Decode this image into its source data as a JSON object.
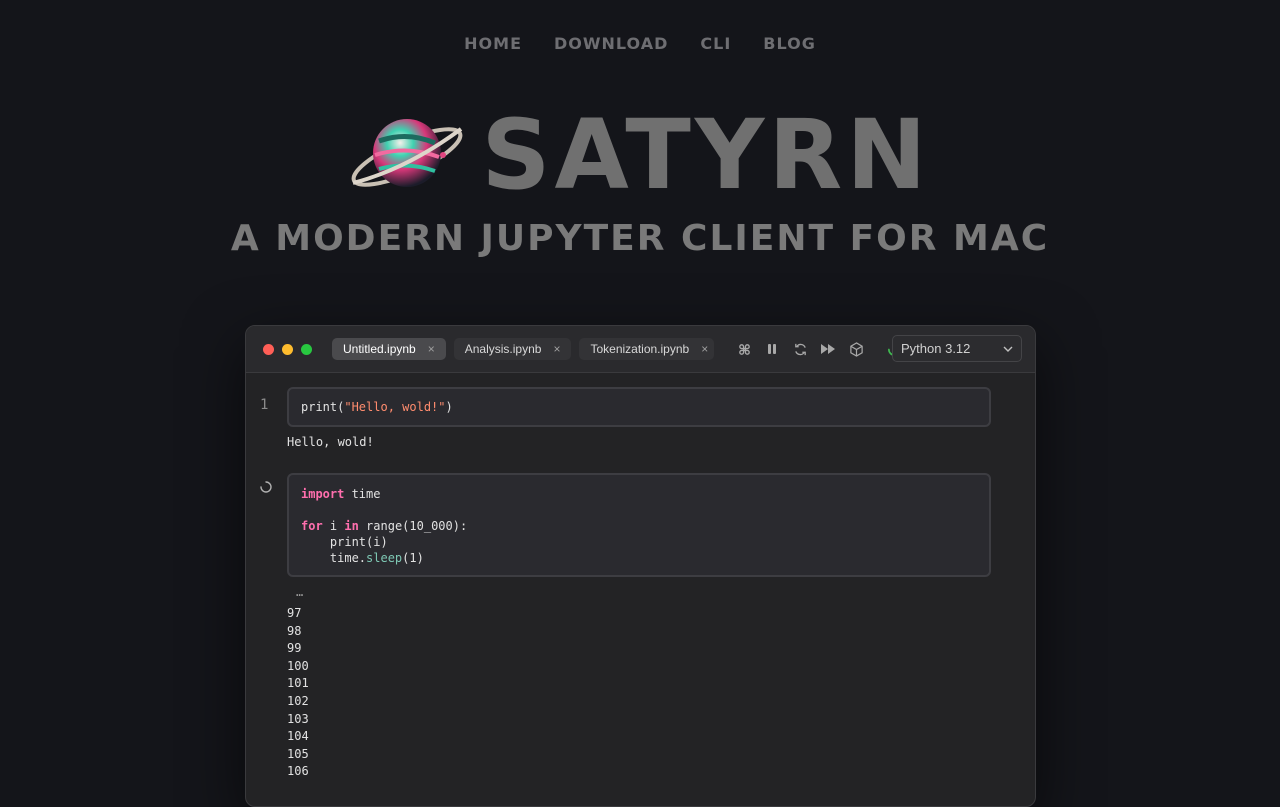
{
  "nav": {
    "items": [
      "Home",
      "Download",
      "CLI",
      "Blog"
    ]
  },
  "hero": {
    "brand": "SATYRN",
    "tagline": "A Modern Jupyter Client for Mac",
    "logo_icon": "planet-logo-icon"
  },
  "window": {
    "tabs": [
      {
        "label": "Untitled.ipynb",
        "active": true
      },
      {
        "label": "Analysis.ipynb",
        "active": false
      },
      {
        "label": "Tokenization.ipynb",
        "active": false
      }
    ],
    "tab_close": "×",
    "tools": [
      "command-icon",
      "pause-icon",
      "restart-icon",
      "run-all-icon",
      "package-icon",
      "kernel-status-icon"
    ],
    "kernel_label": "Python 3.12",
    "colors": {
      "close": "#ff5f57",
      "minimize": "#febc2e",
      "zoom": "#28c840",
      "keyword": "#ff6fae",
      "string": "#ff8c6e",
      "status": "#3fb950"
    }
  },
  "cells": [
    {
      "gutter": "1",
      "code": {
        "fn": "print",
        "open": "(",
        "str": "\"Hello, wold!\"",
        "close": ")"
      },
      "output": "Hello, wold!"
    },
    {
      "gutter_icon": "running-spinner-icon",
      "code": {
        "l1_kw": "import",
        "l1_rest": " time",
        "l3_kw1": "for",
        "l3_mid": " i ",
        "l3_kw2": "in",
        "l3_rest": " range(10_000):",
        "l4": "    print(i)",
        "l5_a": "    time.",
        "l5_attr": "sleep",
        "l5_b": "(1)"
      },
      "ellipsis": "…",
      "outputs": [
        "97",
        "98",
        "99",
        "100",
        "101",
        "102",
        "103",
        "104",
        "105",
        "106"
      ]
    }
  ]
}
